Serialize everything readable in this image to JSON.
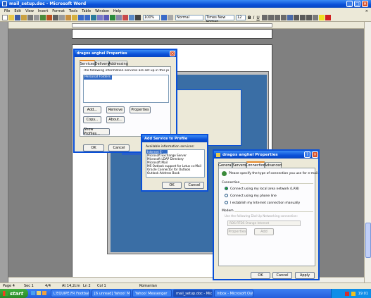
{
  "window": {
    "title": "mail_setup.doc - Microsoft Word"
  },
  "menu": [
    "File",
    "Edit",
    "View",
    "Insert",
    "Format",
    "Tools",
    "Table",
    "Window",
    "Help"
  ],
  "toolbar": {
    "zoom": "100%",
    "style": "Normal",
    "font": "Times New Roman",
    "size": "12"
  },
  "statusbar": {
    "page": "Page 4",
    "sec": "Sec 1",
    "pos": "4/4",
    "at": "At 14,2cm",
    "ln": "Ln 2",
    "col": "Col 1",
    "lang": "Romanian"
  },
  "dlg1": {
    "title": "dragos anghel Properties",
    "tabs": [
      "Services",
      "Delivery",
      "Addressing"
    ],
    "desc": "The following information services are set up in this profile:",
    "items": [
      "Personal Folders"
    ],
    "buttons": {
      "add": "Add...",
      "remove": "Remove",
      "properties": "Properties",
      "copy": "Copy...",
      "about": "About...",
      "show": "Show Profiles...",
      "ok": "OK",
      "cancel": "Cancel"
    }
  },
  "dlg2": {
    "title": "Add Service to Profile",
    "label": "Available information services:",
    "items": [
      "Internet E-mail",
      "Microsoft Exchange Server",
      "Microsoft LDAP Directory",
      "Microsoft Mail",
      "MS Outlook support for Lotus cc:Mail",
      "Oracle Connector for Outlook",
      "Outlook Address Book"
    ],
    "ok": "OK",
    "cancel": "Cancel"
  },
  "dlg3": {
    "title": "dragos anghel Properties",
    "tabs": [
      "General",
      "Servers",
      "Connection",
      "Advanced"
    ],
    "desc": "Please specify the type of connection you use for e-mail.",
    "connection_label": "Connection",
    "opt_lan": "Connect using my local area network (LAN)",
    "opt_phone": "Connect using my phone line",
    "opt_manual": "I establish my Internet connection manually",
    "modem_label": "Modem",
    "modem_check": "Use the following Dial-Up Networking connection:",
    "modem_value": "RDS-RTDS Orange Internet",
    "properties": "Properties",
    "add": "Add",
    "ok": "OK",
    "cancel": "Cancel",
    "apply": "Apply"
  },
  "taskbar": {
    "start": "start",
    "items": [
      "L'EQUIPE.FR Football...",
      "[6 unread] Yahoo! M...",
      "Yahoo! Messenger",
      "mail_setup.doc - Micr...",
      "Inbox - Microsoft Out..."
    ],
    "clock": "19:01"
  }
}
